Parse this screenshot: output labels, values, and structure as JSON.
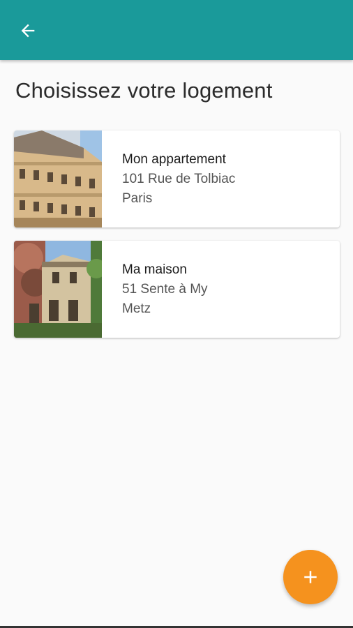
{
  "header": {
    "back_icon": "arrow-back-icon",
    "color": "#1a9a9a"
  },
  "page": {
    "title": "Choisissez votre logement"
  },
  "homes": [
    {
      "name": "Mon appartement",
      "street": "101 Rue de Tolbiac",
      "city": "Paris",
      "image": "apartment-building-photo"
    },
    {
      "name": "Ma maison",
      "street": "51 Sente à My",
      "city": "Metz",
      "image": "house-photo"
    }
  ],
  "fab": {
    "icon": "plus-icon",
    "color": "#f5921e"
  }
}
